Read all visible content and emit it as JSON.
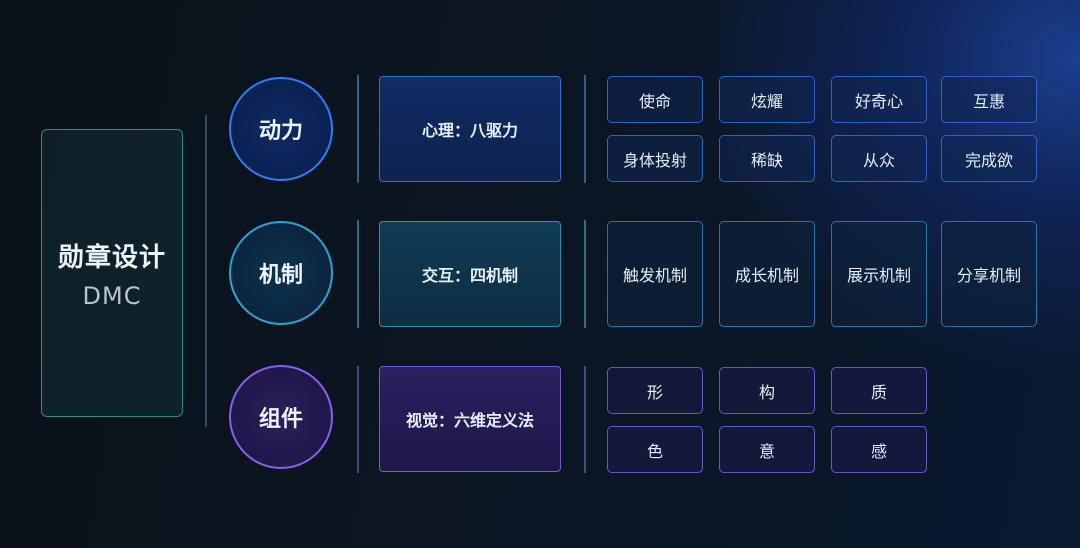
{
  "root": {
    "title": "勋章设计",
    "subtitle": "DMC"
  },
  "rows": [
    {
      "label": "动力",
      "detail": "心理：八驱力",
      "items": [
        "使命",
        "炫耀",
        "好奇心",
        "互惠",
        "身体投射",
        "稀缺",
        "从众",
        "完成欲"
      ]
    },
    {
      "label": "机制",
      "detail": "交互：四机制",
      "items": [
        "触发机制",
        "成长机制",
        "展示机制",
        "分享机制"
      ]
    },
    {
      "label": "组件",
      "detail": "视觉：六维定义法",
      "items": [
        "形",
        "构",
        "质",
        "色",
        "意",
        "感"
      ]
    }
  ],
  "colors": {
    "blue": "#2d7dff",
    "teal": "#2aa3d8",
    "purple": "#8c5cf5"
  }
}
